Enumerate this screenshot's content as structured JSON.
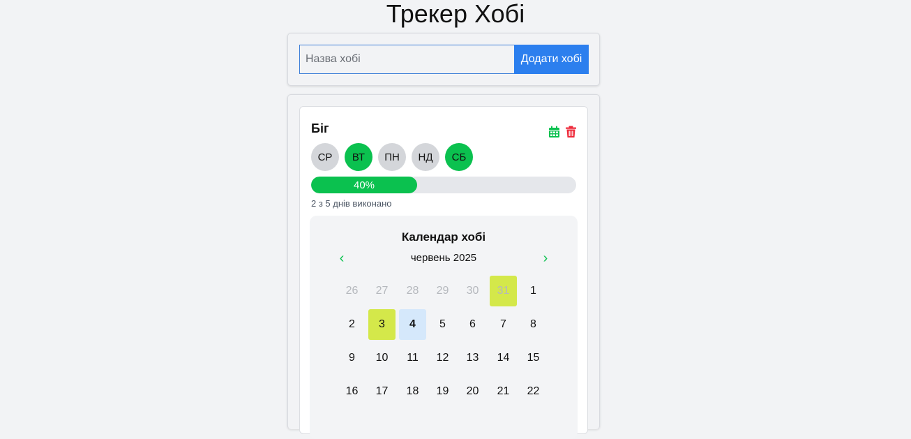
{
  "app": {
    "title": "Трекер Хобі"
  },
  "add_form": {
    "placeholder": "Назва хобі",
    "button_label": "Додати хобі"
  },
  "hobby": {
    "name": "Біг",
    "days": [
      {
        "label": "СР",
        "active": false
      },
      {
        "label": "ВТ",
        "active": true
      },
      {
        "label": "ПН",
        "active": false
      },
      {
        "label": "НД",
        "active": false
      },
      {
        "label": "СБ",
        "active": true
      }
    ],
    "progress_percent": 40,
    "progress_label": "40%",
    "progress_text": "2 з 5 днів виконано",
    "icons": {
      "calendar": "calendar-icon",
      "delete": "trash-icon"
    },
    "colors": {
      "active_day": "#0bc14f",
      "delete": "#ee2a3a",
      "done_day": "#d4e84a",
      "today": "#d5e8fb"
    }
  },
  "calendar": {
    "title": "Календар хобі",
    "month_label": "червень 2025",
    "prev_label": "‹",
    "next_label": "›",
    "weeks": [
      [
        {
          "d": "26",
          "outside": true
        },
        {
          "d": "27",
          "outside": true
        },
        {
          "d": "28",
          "outside": true
        },
        {
          "d": "29",
          "outside": true
        },
        {
          "d": "30",
          "outside": true
        },
        {
          "d": "31",
          "outside": true,
          "done": true
        },
        {
          "d": "1"
        }
      ],
      [
        {
          "d": "2"
        },
        {
          "d": "3",
          "done": true
        },
        {
          "d": "4",
          "today": true
        },
        {
          "d": "5"
        },
        {
          "d": "6"
        },
        {
          "d": "7"
        },
        {
          "d": "8"
        }
      ],
      [
        {
          "d": "9"
        },
        {
          "d": "10"
        },
        {
          "d": "11"
        },
        {
          "d": "12"
        },
        {
          "d": "13"
        },
        {
          "d": "14"
        },
        {
          "d": "15"
        }
      ],
      [
        {
          "d": "16"
        },
        {
          "d": "17"
        },
        {
          "d": "18"
        },
        {
          "d": "19"
        },
        {
          "d": "20"
        },
        {
          "d": "21"
        },
        {
          "d": "22"
        }
      ]
    ]
  }
}
